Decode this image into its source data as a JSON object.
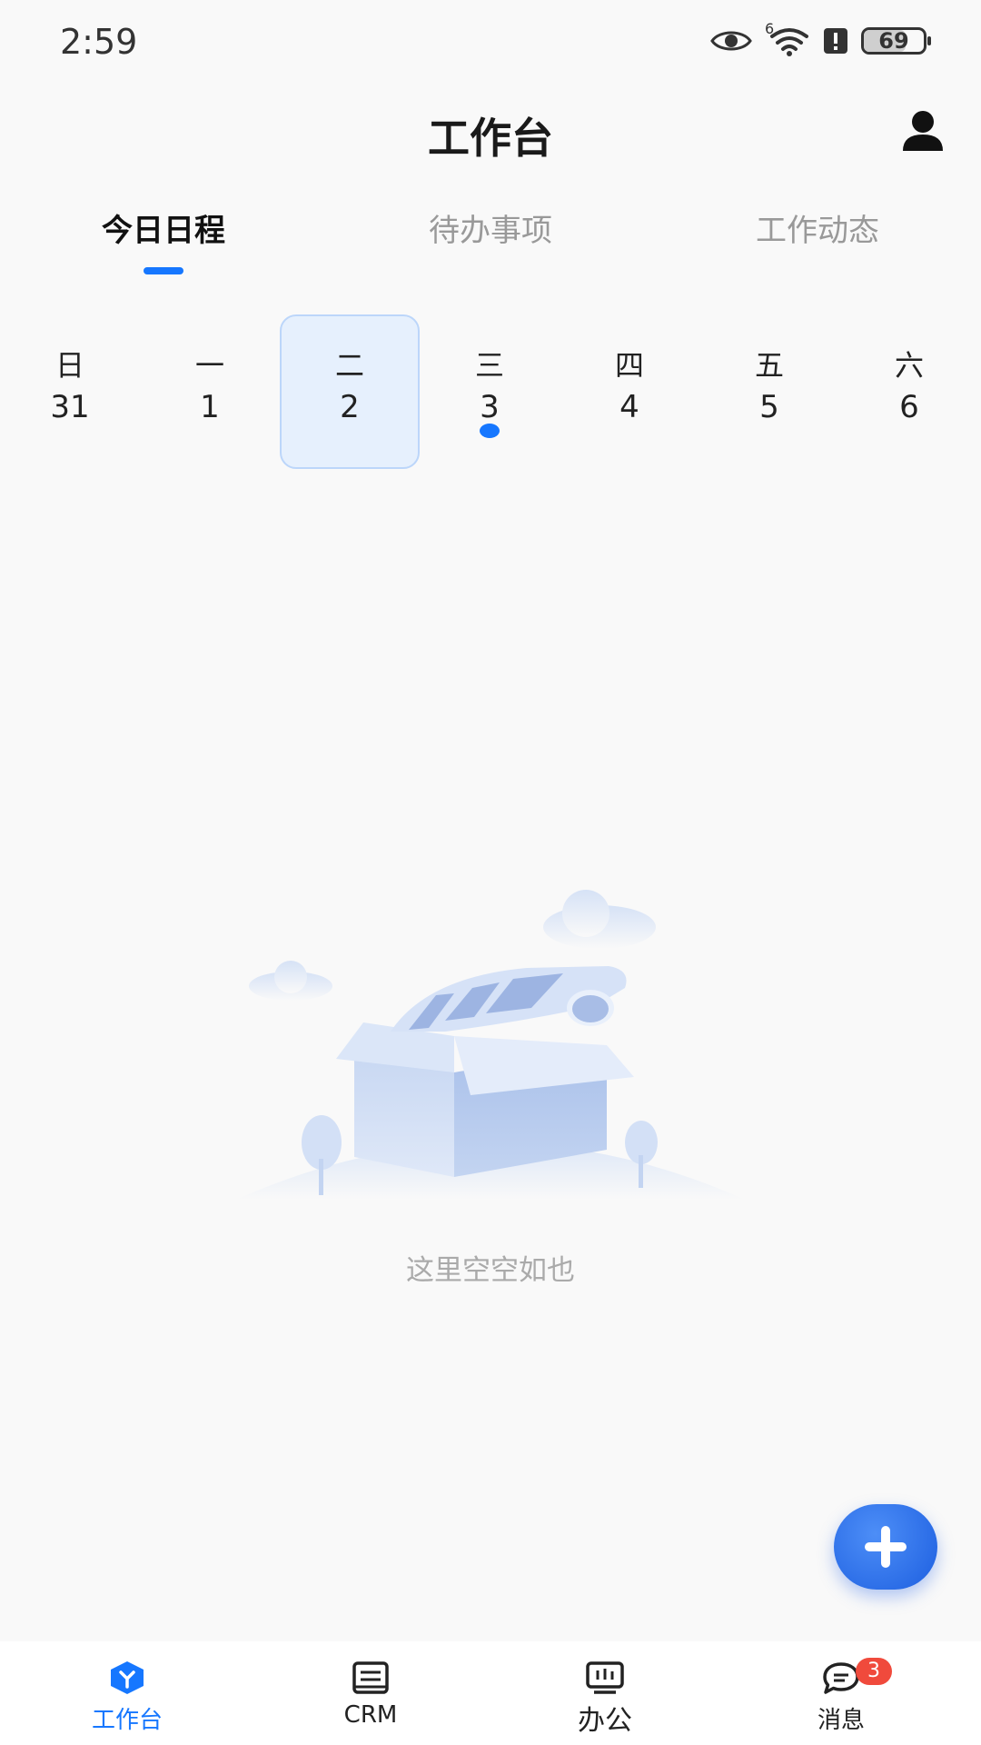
{
  "status_bar": {
    "time": "2:59",
    "battery": "69",
    "battery_level_percent": 69,
    "signal": "6"
  },
  "header": {
    "title": "工作台"
  },
  "tabs": [
    {
      "label": "今日日程",
      "active": true
    },
    {
      "label": "待办事项",
      "active": false
    },
    {
      "label": "工作动态",
      "active": false
    }
  ],
  "week": [
    {
      "weekday": "日",
      "date": "31"
    },
    {
      "weekday": "一",
      "date": "1"
    },
    {
      "weekday": "二",
      "date": "2",
      "selected": true
    },
    {
      "weekday": "三",
      "date": "3",
      "has_event": true
    },
    {
      "weekday": "四",
      "date": "4"
    },
    {
      "weekday": "五",
      "date": "5"
    },
    {
      "weekday": "六",
      "date": "6"
    }
  ],
  "empty_state": {
    "text": "这里空空如也"
  },
  "bottom_nav": [
    {
      "label": "工作台",
      "icon": "workbench-icon",
      "active": true
    },
    {
      "label": "CRM",
      "icon": "crm-icon"
    },
    {
      "label": "办公",
      "icon": "office-icon"
    },
    {
      "label": "消息",
      "icon": "message-icon",
      "badge": "3"
    }
  ],
  "colors": {
    "accent": "#1677ff",
    "badge": "#f04a3c",
    "selected_day_bg": "#e6f0fd"
  }
}
